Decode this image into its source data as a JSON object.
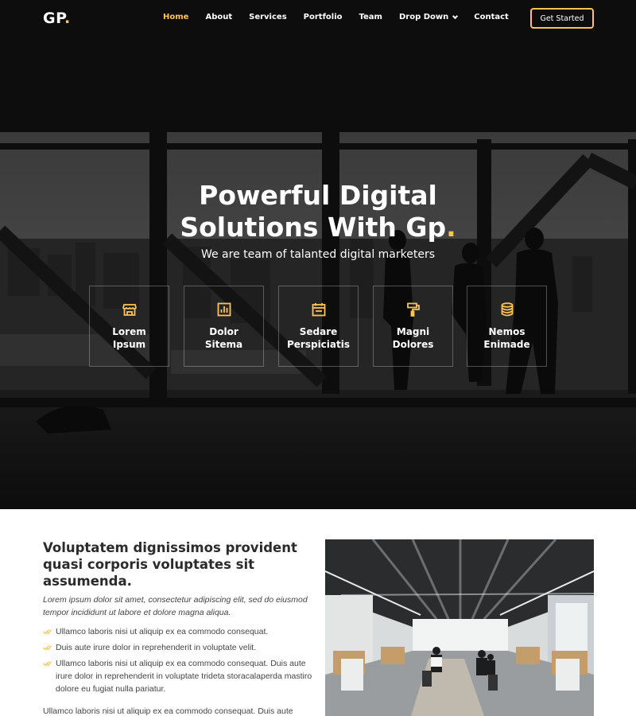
{
  "header": {
    "logo": "GP",
    "logo_dot": ".",
    "nav": [
      {
        "label": "Home",
        "active": true
      },
      {
        "label": "About"
      },
      {
        "label": "Services"
      },
      {
        "label": "Portfolio"
      },
      {
        "label": "Team"
      },
      {
        "label": "Drop Down",
        "icon": "chevron-down-icon"
      },
      {
        "label": "Contact"
      }
    ],
    "cta": "Get Started"
  },
  "hero": {
    "title_line1": "Powerful Digital",
    "title_line2": "Solutions With Gp",
    "title_dot": ".",
    "subtitle": "We are team of talanted digital marketers",
    "boxes": [
      {
        "icon": "store-icon",
        "line1": "Lorem",
        "line2": "Ipsum"
      },
      {
        "icon": "bar-chart-icon",
        "line1": "Dolor",
        "line2": "Sitema"
      },
      {
        "icon": "calendar-icon",
        "line1": "Sedare",
        "line2": "Perspiciatis"
      },
      {
        "icon": "paint-roller-icon",
        "line1": "Magni",
        "line2": "Dolores"
      },
      {
        "icon": "database-icon",
        "line1": "Nemos",
        "line2": "Enimade"
      }
    ]
  },
  "about": {
    "title": "Voluptatem dignissimos provident quasi corporis voluptates sit assumenda.",
    "italic": "Lorem ipsum dolor sit amet, consectetur adipiscing elit, sed do eiusmod tempor incididunt ut labore et dolore magna aliqua.",
    "checks": [
      "Ullamco laboris nisi ut aliquip ex ea commodo consequat.",
      "Duis aute irure dolor in reprehenderit in voluptate velit.",
      "Ullamco laboris nisi ut aliquip ex ea commodo consequat. Duis aute irure dolor in reprehenderit in voluptate trideta storacalaperda mastiro dolore eu fugiat nulla pariatur."
    ],
    "paragraph": "Ullamco laboris nisi ut aliquip ex ea commodo consequat. Duis aute"
  },
  "colors": {
    "accent": "#ffc451",
    "hero_dark": "#151515",
    "heading": "#2b2b2b"
  }
}
